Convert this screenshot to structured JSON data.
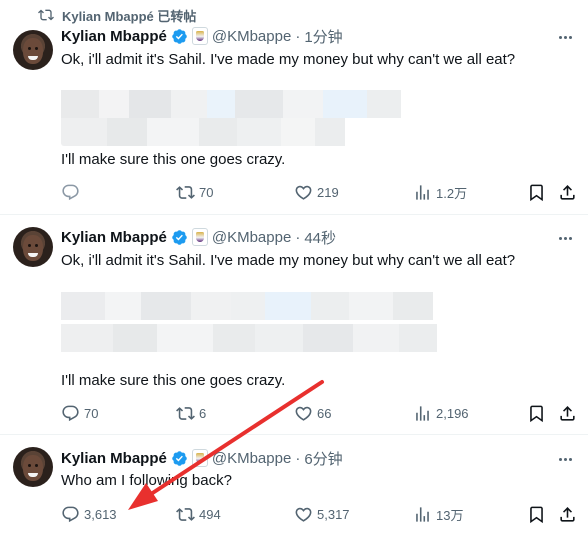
{
  "repost_banner": {
    "text": "Kylian Mbappé 已转帖"
  },
  "tweets": [
    {
      "name": "Kylian Mbappé",
      "handle": "@KMbappe",
      "dot": "·",
      "time": "1分钟",
      "line1": "Ok, i'll admit it's Sahil. I've made my money but why can't we all eat?",
      "line_last": "I'll make sure this one goes crazy.",
      "reply_count": "",
      "repost_count": "70",
      "like_count": "219",
      "view_count": "1.2万"
    },
    {
      "name": "Kylian Mbappé",
      "handle": "@KMbappe",
      "dot": "·",
      "time": "44秒",
      "line1": "Ok, i'll admit it's Sahil. I've made my money but why can't we all eat?",
      "line_last": "I'll make sure this one goes crazy.",
      "reply_count": "70",
      "repost_count": "6",
      "like_count": "66",
      "view_count": "2,196"
    },
    {
      "name": "Kylian Mbappé",
      "handle": "@KMbappe",
      "dot": "·",
      "time": "6分钟",
      "line1": "Who am I following back?",
      "reply_count": "3,613",
      "repost_count": "494",
      "like_count": "5,317",
      "view_count": "13万"
    }
  ],
  "icons": {
    "repost_banner": "repost-icon",
    "verified": "verified-badge-icon",
    "affiliate": "club-crest-icon",
    "more": "more-icon",
    "reply": "reply-icon",
    "repost": "repost-icon",
    "like": "heart-icon",
    "views": "views-icon",
    "bookmark": "bookmark-icon",
    "share": "share-icon"
  },
  "colors": {
    "text_primary": "#0f1419",
    "text_secondary": "#536471",
    "verified_blue": "#1d9bf0",
    "annotation_arrow": "#e8302e",
    "divider": "#eff3f4"
  }
}
